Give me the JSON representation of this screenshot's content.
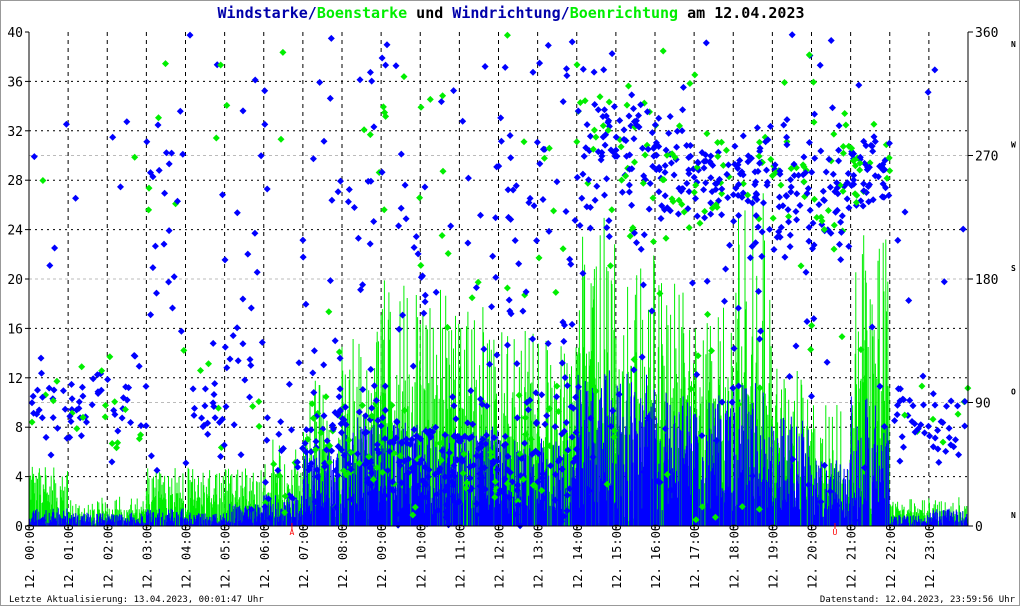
{
  "title": {
    "part1": "Windstarke/",
    "part2": "Boenstarke",
    "part3": " und ",
    "part4": "Windrichtung/",
    "part5": "Boenrichtung",
    "part6": " am 12.04.2023"
  },
  "footer": {
    "left": "Letzte Aktualisierung: 13.04.2023, 00:01:47 Uhr",
    "right": "Datenstand: 12.04.2023, 23:59:56 Uhr"
  },
  "chart_data": {
    "type": "scatter",
    "title": "Windstarke/Boenstarke und Windrichtung/Boenrichtung am 12.04.2023",
    "colors": {
      "wind": "#0000ff",
      "gust": "#00ee00",
      "title_blue": "#0000aa"
    },
    "left_axis": {
      "ylim": [
        0,
        40
      ],
      "ticks": [
        "0",
        "4",
        "8",
        "12",
        "16",
        "20",
        "24",
        "28",
        "32",
        "36",
        "40"
      ]
    },
    "right_axis": {
      "ylim": [
        0,
        360
      ],
      "ticks": [
        "0",
        "90",
        "180",
        "270",
        "360"
      ],
      "compass": [
        "N",
        "O",
        "S",
        "W",
        "N"
      ]
    },
    "x_ticks": [
      "12. 00:00",
      "12. 01:00",
      "12. 02:00",
      "12. 03:00",
      "12. 04:00",
      "12. 05:00",
      "12. 06:00",
      "12. 07:00",
      "12. 08:00",
      "12. 09:00",
      "12. 10:00",
      "12. 11:00",
      "12. 12:00",
      "12. 13:00",
      "12. 14:00",
      "12. 15:00",
      "12. 16:00",
      "12. 17:00",
      "12. 18:00",
      "12. 19:00",
      "12. 20:00",
      "12. 21:00",
      "12. 22:00",
      "12. 23:00"
    ],
    "markers": [
      {
        "label": "A",
        "hour": 6.72,
        "color": "#ff0000"
      },
      {
        "label": "U",
        "hour": 20.6,
        "color": "#ff0000"
      }
    ],
    "hourly": {
      "columns": [
        "hour",
        "wind_mean",
        "gust_max",
        "dir_center",
        "dir_spread",
        "dir_outlier_frac"
      ],
      "rows": [
        [
          0,
          0.8,
          4.8,
          85,
          30,
          0.15
        ],
        [
          1,
          0.6,
          2.4,
          95,
          25,
          0.05
        ],
        [
          2,
          0.6,
          2.4,
          90,
          40,
          0.2
        ],
        [
          3,
          0.8,
          4.8,
          240,
          90,
          0.3
        ],
        [
          4,
          0.6,
          4.8,
          75,
          40,
          0.2
        ],
        [
          5,
          1.0,
          4.8,
          110,
          100,
          0.4
        ],
        [
          6,
          1.5,
          7.2,
          45,
          40,
          0.3
        ],
        [
          7,
          3.5,
          12,
          60,
          45,
          0.3
        ],
        [
          8,
          5.0,
          16,
          55,
          45,
          0.35
        ],
        [
          9,
          5.0,
          20,
          55,
          45,
          0.35
        ],
        [
          10,
          4.5,
          20,
          50,
          40,
          0.35
        ],
        [
          11,
          4.5,
          18,
          50,
          40,
          0.4
        ],
        [
          12,
          4.0,
          16,
          50,
          45,
          0.4
        ],
        [
          13,
          4.0,
          15,
          60,
          50,
          0.5
        ],
        [
          14,
          7.0,
          25,
          270,
          60,
          0.25
        ],
        [
          15,
          7.0,
          22,
          270,
          55,
          0.25
        ],
        [
          16,
          6.0,
          20,
          265,
          50,
          0.2
        ],
        [
          17,
          6.0,
          18,
          250,
          45,
          0.2
        ],
        [
          18,
          6.5,
          27,
          255,
          45,
          0.2
        ],
        [
          19,
          5.0,
          15,
          250,
          50,
          0.25
        ],
        [
          20,
          3.0,
          10,
          240,
          50,
          0.3
        ],
        [
          21,
          6.0,
          24,
          260,
          30,
          0.15
        ],
        [
          22,
          0.5,
          2.4,
          80,
          25,
          0.1
        ],
        [
          23,
          0.8,
          2.4,
          70,
          30,
          0.15
        ]
      ]
    }
  }
}
